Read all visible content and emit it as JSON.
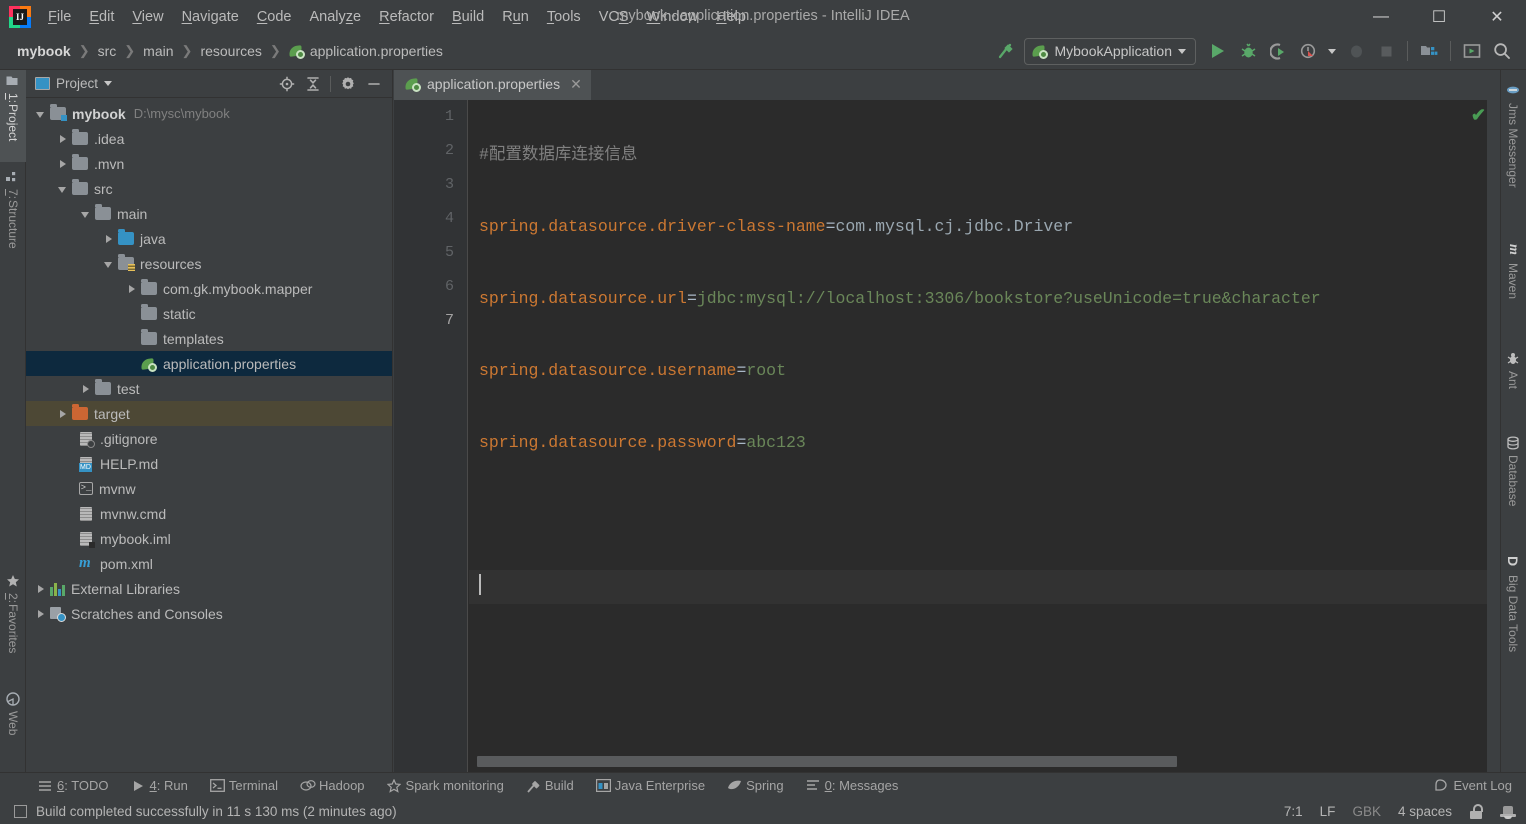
{
  "window": {
    "title": "mybook - application.properties - IntelliJ IDEA",
    "minimize_label": "─",
    "maximize_label": "☐",
    "close_label": "✕"
  },
  "menu": {
    "items": [
      {
        "label": "File",
        "mnemonic": "F"
      },
      {
        "label": "Edit",
        "mnemonic": "E"
      },
      {
        "label": "View",
        "mnemonic": "V"
      },
      {
        "label": "Navigate",
        "mnemonic": "N"
      },
      {
        "label": "Code",
        "mnemonic": "C"
      },
      {
        "label": "Analyze",
        "mnemonic": "z"
      },
      {
        "label": "Refactor",
        "mnemonic": "R"
      },
      {
        "label": "Build",
        "mnemonic": "B"
      },
      {
        "label": "Run",
        "mnemonic": "R"
      },
      {
        "label": "Tools",
        "mnemonic": "T"
      },
      {
        "label": "VCS",
        "mnemonic": "S"
      },
      {
        "label": "Window",
        "mnemonic": "W"
      },
      {
        "label": "Help",
        "mnemonic": "H"
      }
    ]
  },
  "navbar": {
    "breadcrumbs": [
      "mybook",
      "src",
      "main",
      "resources",
      "application.properties"
    ],
    "separator": "❯",
    "run_config": "MybookApplication",
    "icons": [
      "build-hammer-icon",
      "run-icon",
      "debug-icon",
      "run-coverage-icon",
      "profiler-icon",
      "stop-rerun-icon",
      "stop-icon",
      "project-structure-icon",
      "updates-icon",
      "search-everywhere-icon"
    ]
  },
  "left_strip": {
    "tabs": [
      {
        "label": "1: Project",
        "number": "1",
        "text": ": Project",
        "icon": "project-icon",
        "active": true
      },
      {
        "label": "7: Structure",
        "number": "7",
        "text": ": Structure",
        "icon": "structure-icon",
        "active": false
      },
      {
        "label": "2: Favorites",
        "number": "2",
        "text": ": Favorites",
        "icon": "favorites-star-icon",
        "active": false
      },
      {
        "label": "Web",
        "number": "",
        "text": "Web",
        "icon": "web-globe-icon",
        "active": false
      }
    ]
  },
  "right_strip": {
    "tabs": [
      {
        "label": "Jms Messenger",
        "icon": "jms-messenger-icon"
      },
      {
        "label": "Maven",
        "icon": "maven-icon"
      },
      {
        "label": "Ant",
        "icon": "ant-icon"
      },
      {
        "label": "Database",
        "icon": "database-icon"
      },
      {
        "label": "Big Data Tools",
        "icon": "big-data-tools-icon"
      }
    ]
  },
  "project_panel": {
    "title": "Project",
    "toolbar_icons": [
      "locate-icon",
      "collapse-all-icon",
      "settings-gear-icon",
      "hide-icon"
    ],
    "tree": [
      {
        "indent": 0,
        "arrow": "down",
        "icon": "module-folder",
        "label": "mybook",
        "path": "D:\\mysc\\mybook",
        "bold": true,
        "state": "normal"
      },
      {
        "indent": 1,
        "arrow": "right",
        "icon": "folder",
        "label": ".idea",
        "path": "",
        "bold": false,
        "state": "normal"
      },
      {
        "indent": 1,
        "arrow": "right",
        "icon": "folder",
        "label": ".mvn",
        "path": "",
        "bold": false,
        "state": "normal"
      },
      {
        "indent": 1,
        "arrow": "down",
        "icon": "folder",
        "label": "src",
        "path": "",
        "bold": false,
        "state": "normal"
      },
      {
        "indent": 2,
        "arrow": "down",
        "icon": "folder",
        "label": "main",
        "path": "",
        "bold": false,
        "state": "normal"
      },
      {
        "indent": 3,
        "arrow": "right",
        "icon": "source-folder",
        "label": "java",
        "path": "",
        "bold": false,
        "state": "normal"
      },
      {
        "indent": 3,
        "arrow": "down",
        "icon": "resource-folder",
        "label": "resources",
        "path": "",
        "bold": false,
        "state": "normal"
      },
      {
        "indent": 4,
        "arrow": "right",
        "icon": "folder",
        "label": "com.gk.mybook.mapper",
        "path": "",
        "bold": false,
        "state": "normal"
      },
      {
        "indent": 4,
        "arrow": "none",
        "icon": "folder",
        "label": "static",
        "path": "",
        "bold": false,
        "state": "normal"
      },
      {
        "indent": 4,
        "arrow": "none",
        "icon": "folder",
        "label": "templates",
        "path": "",
        "bold": false,
        "state": "normal"
      },
      {
        "indent": 4,
        "arrow": "none",
        "icon": "spring-properties-file",
        "label": "application.properties",
        "path": "",
        "bold": false,
        "state": "selected"
      },
      {
        "indent": 2,
        "arrow": "right",
        "icon": "folder",
        "label": "test",
        "path": "",
        "bold": false,
        "state": "normal"
      },
      {
        "indent": 1,
        "arrow": "right",
        "icon": "excluded-folder",
        "label": "target",
        "path": "",
        "bold": false,
        "state": "excluded"
      },
      {
        "indent": 1,
        "arrow": "none",
        "icon": "gitignore-file",
        "label": ".gitignore",
        "path": "",
        "bold": false,
        "state": "normal"
      },
      {
        "indent": 1,
        "arrow": "none",
        "icon": "markdown-file",
        "label": "HELP.md",
        "path": "",
        "bold": false,
        "state": "normal"
      },
      {
        "indent": 1,
        "arrow": "none",
        "icon": "shell-file",
        "label": "mvnw",
        "path": "",
        "bold": false,
        "state": "normal"
      },
      {
        "indent": 1,
        "arrow": "none",
        "icon": "cmd-file",
        "label": "mvnw.cmd",
        "path": "",
        "bold": false,
        "state": "normal"
      },
      {
        "indent": 1,
        "arrow": "none",
        "icon": "iml-file",
        "label": "mybook.iml",
        "path": "",
        "bold": false,
        "state": "normal"
      },
      {
        "indent": 1,
        "arrow": "none",
        "icon": "maven-pom-file",
        "label": "pom.xml",
        "path": "",
        "bold": false,
        "state": "normal"
      },
      {
        "indent": 0,
        "arrow": "right",
        "icon": "external-libraries-icon",
        "label": "External Libraries",
        "path": "",
        "bold": false,
        "state": "normal"
      },
      {
        "indent": 0,
        "arrow": "right",
        "icon": "scratches-icon",
        "label": "Scratches and Consoles",
        "path": "",
        "bold": false,
        "state": "normal"
      }
    ]
  },
  "editor": {
    "tab": {
      "label": "application.properties",
      "icon": "spring-properties-file",
      "close": "✕"
    },
    "inspection_status": "✔",
    "line_numbers": [
      "1",
      "2",
      "3",
      "4",
      "5",
      "6",
      "7"
    ],
    "current_line": 7,
    "lines": [
      {
        "num": "1",
        "type": "comment",
        "text": "#配置数据库连接信息"
      },
      {
        "num": "2",
        "type": "property",
        "key": "spring.datasource.driver-class-name",
        "eq": "=",
        "value": "com.mysql.cj.jdbc.Driver",
        "value_style": "class"
      },
      {
        "num": "3",
        "type": "property",
        "key": "spring.datasource.url",
        "eq": "=",
        "value": "jdbc:mysql://localhost:3306/bookstore?useUnicode=true&character",
        "value_style": "string"
      },
      {
        "num": "4",
        "type": "property",
        "key": "spring.datasource.username",
        "eq": "=",
        "value": "root",
        "value_style": "string"
      },
      {
        "num": "5",
        "type": "property",
        "key": "spring.datasource.password",
        "eq": "=",
        "value": "abc123",
        "value_style": "string"
      },
      {
        "num": "6",
        "type": "blank",
        "text": ""
      },
      {
        "num": "7",
        "type": "blank",
        "text": ""
      }
    ]
  },
  "bottom_strip": {
    "tabs": [
      {
        "label": "6: TODO",
        "number": "6",
        "text": ": TODO",
        "icon": "todo-icon"
      },
      {
        "label": "4: Run",
        "number": "4",
        "text": ": Run",
        "icon": "run-icon"
      },
      {
        "label": "Terminal",
        "number": "",
        "text": "Terminal",
        "icon": "terminal-icon"
      },
      {
        "label": "Hadoop",
        "number": "",
        "text": "Hadoop",
        "icon": "hadoop-icon"
      },
      {
        "label": "Spark monitoring",
        "number": "",
        "text": "Spark monitoring",
        "icon": "spark-star-icon"
      },
      {
        "label": "Build",
        "number": "",
        "text": "Build",
        "icon": "build-hammer-icon"
      },
      {
        "label": "Java Enterprise",
        "number": "",
        "text": "Java Enterprise",
        "icon": "java-enterprise-icon"
      },
      {
        "label": "Spring",
        "number": "",
        "text": "Spring",
        "icon": "spring-leaf-icon"
      },
      {
        "label": "0: Messages",
        "number": "0",
        "text": ": Messages",
        "icon": "messages-icon"
      }
    ],
    "event_log": "Event Log",
    "event_log_icon": "event-log-balloon-icon"
  },
  "statusbar": {
    "icon": "message-box-icon",
    "message": "Build completed successfully in 11 s 130 ms (2 minutes ago)",
    "caret_position": "7:1",
    "line_separator": "LF",
    "encoding": "GBK",
    "indent": "4 spaces",
    "lock_icon": "unlocked-write-icon",
    "inspection_icon": "inspection-hector-icon"
  },
  "colors": {
    "panel_bg": "#3c3f41",
    "editor_bg": "#2b2b2b",
    "gutter_bg": "#313335",
    "selection_bg": "#0d293e",
    "excluded_bg": "#4d4835",
    "accent_green": "#59a869",
    "accent_blue": "#3592c4",
    "text": "#bbbbbb",
    "key_orange": "#cc7832",
    "string_green": "#6a8759",
    "comment_gray": "#808080",
    "class_gray": "#9aa7b0"
  }
}
